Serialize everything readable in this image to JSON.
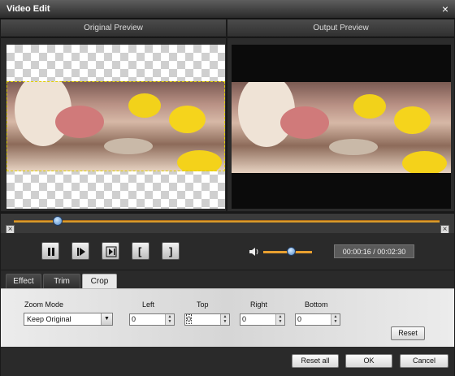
{
  "window": {
    "title": "Video Edit",
    "close_glyph": "×"
  },
  "preview": {
    "original_label": "Original Preview",
    "output_label": "Output Preview"
  },
  "timeline": {
    "position_fraction": 0.1
  },
  "playback": {
    "buttons": [
      "pause-icon",
      "play-step-icon",
      "next-frame-icon",
      "mark-in-icon",
      "mark-out-icon"
    ],
    "mark_in_glyph": "[",
    "mark_out_glyph": "]",
    "time_display": "00:00:16 / 00:02:30",
    "volume_fraction": 0.5
  },
  "tabs": [
    "Effect",
    "Trim",
    "Crop"
  ],
  "active_tab": "Crop",
  "crop": {
    "zoom_mode_label": "Zoom Mode",
    "zoom_mode_value": "Keep Original",
    "left_label": "Left",
    "left_value": "0",
    "top_label": "Top",
    "top_value": "0",
    "right_label": "Right",
    "right_value": "0",
    "bottom_label": "Bottom",
    "bottom_value": "0",
    "reset_label": "Reset"
  },
  "footer": {
    "reset_all_label": "Reset all",
    "ok_label": "OK",
    "cancel_label": "Cancel"
  },
  "colors": {
    "accent_track": "#d89a2a",
    "crop_frame": "#e0d000"
  }
}
